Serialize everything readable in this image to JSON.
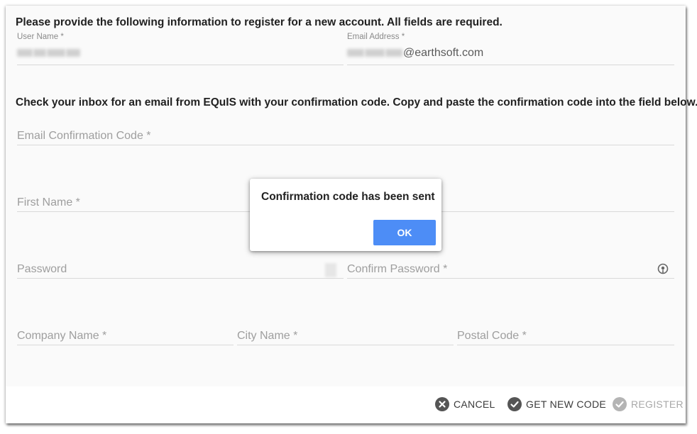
{
  "form": {
    "intro": "Please provide the following information to register for a new account. All fields are required.",
    "instructions": "Check your inbox for an email from EQuIS with your confirmation code. Copy and paste the confirmation code into the field below.",
    "user_name": {
      "label": "User Name *"
    },
    "email": {
      "label": "Email Address *",
      "value_suffix": "@earthsoft.com"
    },
    "confirmation_code": {
      "placeholder": "Email Confirmation Code *"
    },
    "first_name": {
      "placeholder": "First Name *"
    },
    "last_name": {
      "placeholder": ""
    },
    "password": {
      "placeholder": "Password"
    },
    "confirm_password": {
      "placeholder": "Confirm Password *"
    },
    "company": {
      "placeholder": "Company Name *"
    },
    "city": {
      "placeholder": "City Name *"
    },
    "postal": {
      "placeholder": "Postal Code *"
    }
  },
  "footer": {
    "cancel_label": "CANCEL",
    "new_code_label": "GET NEW CODE",
    "register_label": "REGISTER"
  },
  "dialog": {
    "message": "Confirmation code has been sent",
    "ok_label": "OK"
  },
  "icons": {
    "cancel": "close-circle-icon",
    "new_code": "check-circle-icon",
    "register": "check-circle-icon",
    "password_toggle": "eye-icon"
  },
  "colors": {
    "primary": "#4d8df6",
    "background": "#fafafa",
    "text": "#212121"
  }
}
